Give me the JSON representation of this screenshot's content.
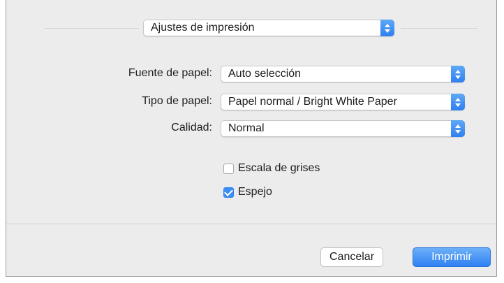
{
  "panel_selector": {
    "value": "Ajustes de impresión"
  },
  "fields": {
    "paper_source": {
      "label": "Fuente de papel:",
      "value": "Auto selección"
    },
    "paper_type": {
      "label": "Tipo de papel:",
      "value": "Papel normal / Bright White Paper"
    },
    "quality": {
      "label": "Calidad:",
      "value": "Normal"
    }
  },
  "options": {
    "grayscale": {
      "label": "Escala de grises",
      "checked": false
    },
    "mirror": {
      "label": "Espejo",
      "checked": true
    }
  },
  "buttons": {
    "cancel": "Cancelar",
    "print": "Imprimir"
  },
  "colors": {
    "accent": "#3d8ef3",
    "dialog_background": "#ececec"
  }
}
